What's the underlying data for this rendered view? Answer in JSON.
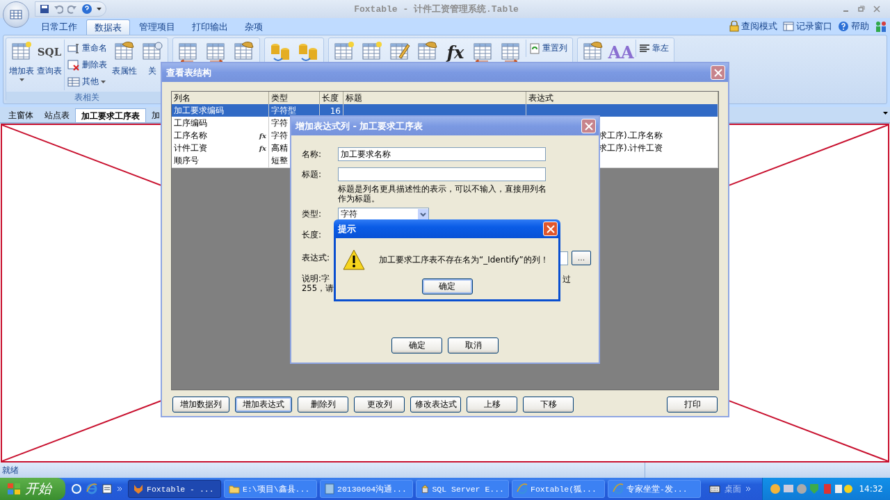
{
  "window": {
    "title": "Foxtable - 计件工资管理系统.Table"
  },
  "menu_tabs": [
    {
      "label": "日常工作",
      "selected": false
    },
    {
      "label": "数据表",
      "selected": true
    },
    {
      "label": "管理项目",
      "selected": false
    },
    {
      "label": "打印输出",
      "selected": false
    },
    {
      "label": "杂项",
      "selected": false
    }
  ],
  "header_links": [
    {
      "kind": "lock",
      "label": "查阅模式"
    },
    {
      "kind": "window",
      "label": "记录窗口"
    },
    {
      "kind": "help",
      "label": "帮助"
    }
  ],
  "ribbon": {
    "groups": [
      {
        "label": "表相关",
        "items": [
          {
            "kind": "tablestar",
            "label": "增加表",
            "dropdown": true
          },
          {
            "kind": "glyph",
            "glyph": "SQL",
            "label": "查询表"
          },
          {
            "kind": "stack",
            "items": [
              {
                "kind": "rename",
                "label": "重命名"
              },
              {
                "kind": "tabledelete",
                "label": "删除表"
              },
              {
                "kind": "table",
                "label": "其他",
                "dropdown": true
              }
            ]
          },
          {
            "kind": "dochand",
            "label": "表属性"
          },
          {
            "kind": "relation",
            "label": "关"
          }
        ]
      },
      {
        "items": [
          {
            "kind": "tableleft"
          },
          {
            "kind": "tableright"
          },
          {
            "kind": "tablehand"
          }
        ]
      },
      {
        "items": [
          {
            "kind": "dbup"
          },
          {
            "kind": "dbtable"
          }
        ]
      },
      {
        "items": [
          {
            "kind": "colstar"
          },
          {
            "kind": "colstar"
          },
          {
            "kind": "coledit"
          },
          {
            "kind": "dochand"
          },
          {
            "kind": "glyph",
            "glyph": "fx"
          },
          {
            "kind": "tableleft"
          },
          {
            "kind": "tableright"
          },
          {
            "kind": "stack",
            "items": [
              {
                "kind": "refresh",
                "label": "重置列"
              }
            ]
          }
        ]
      },
      {
        "items": [
          {
            "kind": "calendarhand"
          },
          {
            "kind": "glyph",
            "glyph": "AA"
          },
          {
            "kind": "stack",
            "items": [
              {
                "kind": "alignleft",
                "label": "靠左"
              }
            ]
          }
        ]
      }
    ]
  },
  "doc_tabs": [
    {
      "label": "主窗体",
      "selected": false
    },
    {
      "label": "站点表",
      "selected": false
    },
    {
      "label": "加工要求工序表",
      "selected": true
    },
    {
      "label": "加",
      "selected": false
    }
  ],
  "structure_dialog": {
    "title": "查看表结构",
    "columns": [
      "列名",
      "类型",
      "长度",
      "标题",
      "表达式"
    ],
    "rows": [
      {
        "cells": [
          "加工要求编码",
          "字符型",
          "16",
          "",
          ""
        ],
        "selected": true
      },
      {
        "cells": [
          "工序编码",
          "字符",
          "",
          "",
          ""
        ],
        "selected": false
      },
      {
        "cells": [
          "工序名称",
          "字符",
          "",
          "",
          "求工序).工序名称"
        ],
        "formula": "fx",
        "selected": false
      },
      {
        "cells": [
          "计件工资",
          "高精",
          "",
          "",
          "求工序).计件工资"
        ],
        "formula": "fx",
        "selected": false
      },
      {
        "cells": [
          "顺序号",
          "短整",
          "",
          "",
          ""
        ],
        "selected": false
      }
    ],
    "buttons": [
      {
        "label": "增加数据列",
        "focused": false
      },
      {
        "label": "增加表达式",
        "focused": true
      },
      {
        "label": "删除列",
        "focused": false
      },
      {
        "label": "更改列",
        "focused": false
      },
      {
        "label": "修改表达式",
        "focused": false
      },
      {
        "label": "上移",
        "focused": false
      },
      {
        "label": "下移",
        "focused": false
      }
    ],
    "print_button": "打印"
  },
  "expression_dialog": {
    "title": "增加表达式列 - 加工要求工序表",
    "name": {
      "label": "名称:",
      "value": "加工要求名称"
    },
    "caption": {
      "label": "标题:"
    },
    "hint": "标题是列名更具描述性的表示，可以不输入，直接用列名作为标题。",
    "type": {
      "label": "类型:",
      "value": "字符"
    },
    "length": {
      "label": "长度:"
    },
    "expression": {
      "label": "表达式:",
      "button": "..."
    },
    "note_left": [
      "说明:字",
      "255，请"
    ],
    "note_right": "过",
    "buttons": [
      "确定",
      "取消"
    ]
  },
  "alert": {
    "title": "提示",
    "message": "加工要求工序表不存在名为“_Identify”的列！",
    "button": "确定"
  },
  "status_bar": {
    "text": "就绪"
  },
  "taskbar": {
    "start": "开始",
    "tasks": [
      {
        "kind": "fox",
        "label": "Foxtable - ...",
        "selected": true
      },
      {
        "kind": "folder",
        "label": "E:\\项目\\鑫县...",
        "selected": false
      },
      {
        "kind": "doc",
        "label": "20130604沟通...",
        "selected": false
      },
      {
        "kind": "tool",
        "label": "SQL Server E...",
        "selected": false
      },
      {
        "kind": "ie",
        "label": "Foxtable(狐...",
        "selected": false
      },
      {
        "kind": "ie",
        "label": "专家坐堂-发...",
        "selected": false
      }
    ],
    "desktop": "桌面",
    "clock": "14:32"
  }
}
